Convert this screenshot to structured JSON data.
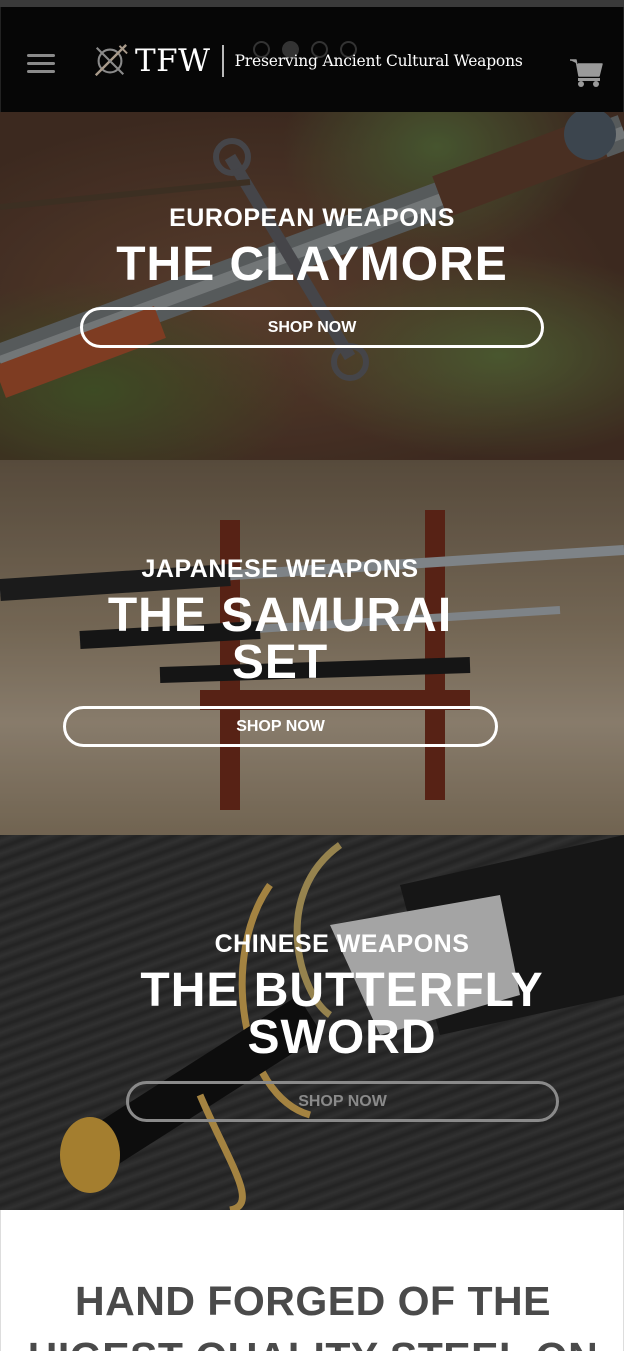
{
  "header": {
    "logo_text": "TFW",
    "tagline": "Preserving Ancient Cultural Weapons",
    "slider_dots": 4,
    "active_dot": 1
  },
  "slides": [
    {
      "subtitle": "EUROPEAN WEAPONS",
      "title": "THE CLAYMORE",
      "button": "SHOP NOW"
    },
    {
      "subtitle": "JAPANESE WEAPONS",
      "title_line1": "THE SAMURAI",
      "title_line2": "SET",
      "button": "SHOP NOW"
    },
    {
      "subtitle": "CHINESE WEAPONS",
      "title_line1": "THE BUTTERFLY",
      "title_line2": "SWORD",
      "button": "SHOP NOW"
    }
  ],
  "section": {
    "heading": "HAND FORGED OF THE HIGEST QUALITY STEEL ON"
  },
  "colors": {
    "header_bg": "#060606",
    "heading_text": "#4a4a4a"
  }
}
